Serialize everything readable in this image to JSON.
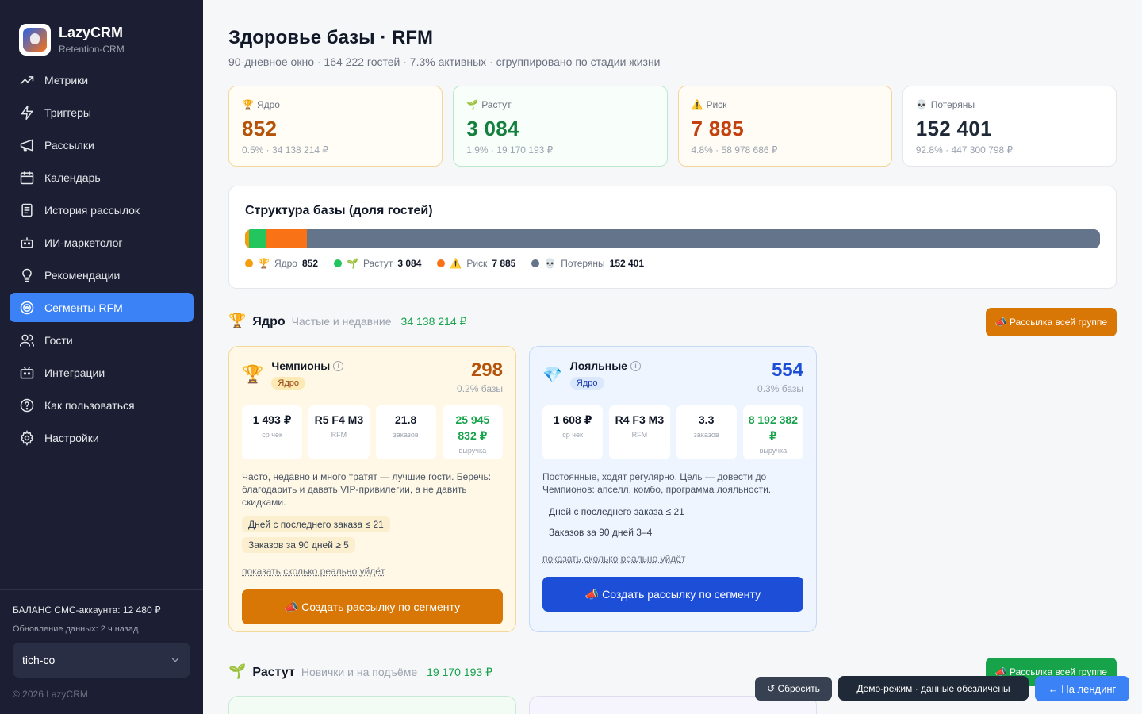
{
  "brand": {
    "title": "LazyCRM",
    "subtitle": "Retention-CRM"
  },
  "nav": [
    {
      "label": "Метрики",
      "icon": "trend-up-icon",
      "name": "nav-metrics"
    },
    {
      "label": "Триггеры",
      "icon": "bolt-icon",
      "name": "nav-triggers"
    },
    {
      "label": "Рассылки",
      "icon": "megaphone-icon",
      "name": "nav-mailings"
    },
    {
      "label": "Календарь",
      "icon": "calendar-icon",
      "name": "nav-calendar"
    },
    {
      "label": "История рассылок",
      "icon": "document-icon",
      "name": "nav-history"
    },
    {
      "label": "ИИ-маркетолог",
      "icon": "robot-icon",
      "name": "nav-ai"
    },
    {
      "label": "Рекомендации",
      "icon": "lightbulb-icon",
      "name": "nav-recommendations"
    },
    {
      "label": "Сегменты RFM",
      "icon": "target-icon",
      "name": "nav-rfm",
      "active": true
    },
    {
      "label": "Гости",
      "icon": "users-icon",
      "name": "nav-guests"
    },
    {
      "label": "Интеграции",
      "icon": "plug-icon",
      "name": "nav-integrations"
    },
    {
      "label": "Как пользоваться",
      "icon": "help-icon",
      "name": "nav-help"
    },
    {
      "label": "Настройки",
      "icon": "gear-icon",
      "name": "nav-settings"
    }
  ],
  "sidebar_footer": {
    "balance": "БАЛАНС СМС-аккаунта: 12 480 ₽",
    "updated": "Обновление данных: 2 ч назад",
    "org": "tich-co",
    "copyright": "© 2026 LazyCRM"
  },
  "header": {
    "title": "Здоровье базы · RFM",
    "subtitle": "90-дневное окно · 164 222 гостей · 7.3% активных · сгруппировано по стадии жизни"
  },
  "stats": [
    {
      "emoji": "🏆",
      "label": "Ядро",
      "value": "852",
      "meta": "0.5% · 34 138 214 ₽",
      "color": "#b45309"
    },
    {
      "emoji": "🌱",
      "label": "Растут",
      "value": "3 084",
      "meta": "1.9% · 19 170 193 ₽",
      "color": "#15803d"
    },
    {
      "emoji": "⚠️",
      "label": "Риск",
      "value": "7 885",
      "meta": "4.8% · 58 978 686 ₽",
      "color": "#c2410c"
    },
    {
      "emoji": "💀",
      "label": "Потеряны",
      "value": "152 401",
      "meta": "92.8% · 447 300 798 ₽",
      "color": "#1f2937"
    }
  ],
  "structure": {
    "title": "Структура базы (доля гостей)",
    "segments": [
      {
        "emoji": "🏆",
        "label": "Ядро",
        "value": "852",
        "share": 0.5,
        "color": "#f59e0b"
      },
      {
        "emoji": "🌱",
        "label": "Растут",
        "value": "3 084",
        "share": 1.9,
        "color": "#22c55e"
      },
      {
        "emoji": "⚠️",
        "label": "Риск",
        "value": "7 885",
        "share": 4.8,
        "color": "#f97316"
      },
      {
        "emoji": "💀",
        "label": "Потеряны",
        "value": "152 401",
        "share": 92.8,
        "color": "#64748b"
      }
    ]
  },
  "groups": {
    "core": {
      "emoji": "🏆",
      "name": "Ядро",
      "desc": "Частые и недавние",
      "revenue": "34 138 214 ₽",
      "button": "📣 Рассылка всей группе",
      "button_color": "#d97706"
    },
    "grow": {
      "emoji": "🌱",
      "name": "Растут",
      "desc": "Новички и на подъёме",
      "revenue": "19 170 193 ₽",
      "button": "📣 Рассылка всей группе",
      "button_color": "#16a34a"
    }
  },
  "segments": {
    "champions": {
      "emoji": "🏆",
      "title": "Чемпионы",
      "badge": "Ядро",
      "count": "298",
      "share": "0.2% базы",
      "metrics": [
        {
          "value": "1 493 ₽",
          "label": "ср чек"
        },
        {
          "value": "R5 F4 M3",
          "label": "RFM"
        },
        {
          "value": "21.8",
          "label": "заказов"
        },
        {
          "value": "25 945 832 ₽",
          "label": "выручка"
        }
      ],
      "desc": "Часто, недавно и много тратят — лучшие гости. Беречь: благодарить и давать VIP-привилегии, а не давить скидками.",
      "conditions": [
        "Дней с последнего заказа ≤ 21",
        "Заказов за 90 дней ≥ 5"
      ],
      "link": "показать сколько реально уйдёт",
      "button": "📣 Создать рассылку по сегменту",
      "button_color": "#d97706"
    },
    "loyal": {
      "emoji": "💎",
      "title": "Лояльные",
      "badge": "Ядро",
      "count": "554",
      "share": "0.3% базы",
      "metrics": [
        {
          "value": "1 608 ₽",
          "label": "ср чек"
        },
        {
          "value": "R4 F3 M3",
          "label": "RFM"
        },
        {
          "value": "3.3",
          "label": "заказов"
        },
        {
          "value": "8 192 382 ₽",
          "label": "выручка"
        }
      ],
      "desc": "Постоянные, ходят регулярно. Цель — довести до Чемпионов: апселл, комбо, программа лояльности.",
      "conditions": [
        "Дней с последнего заказа ≤ 21",
        "Заказов за 90 дней 3–4"
      ],
      "link": "показать сколько реально уйдёт",
      "button": "📣 Создать рассылку по сегменту",
      "button_color": "#1d4ed8"
    }
  },
  "floating": {
    "reset": "↺ Сбросить",
    "demo": "Демо-режим · данные обезличены",
    "landing": "← На лендинг"
  }
}
